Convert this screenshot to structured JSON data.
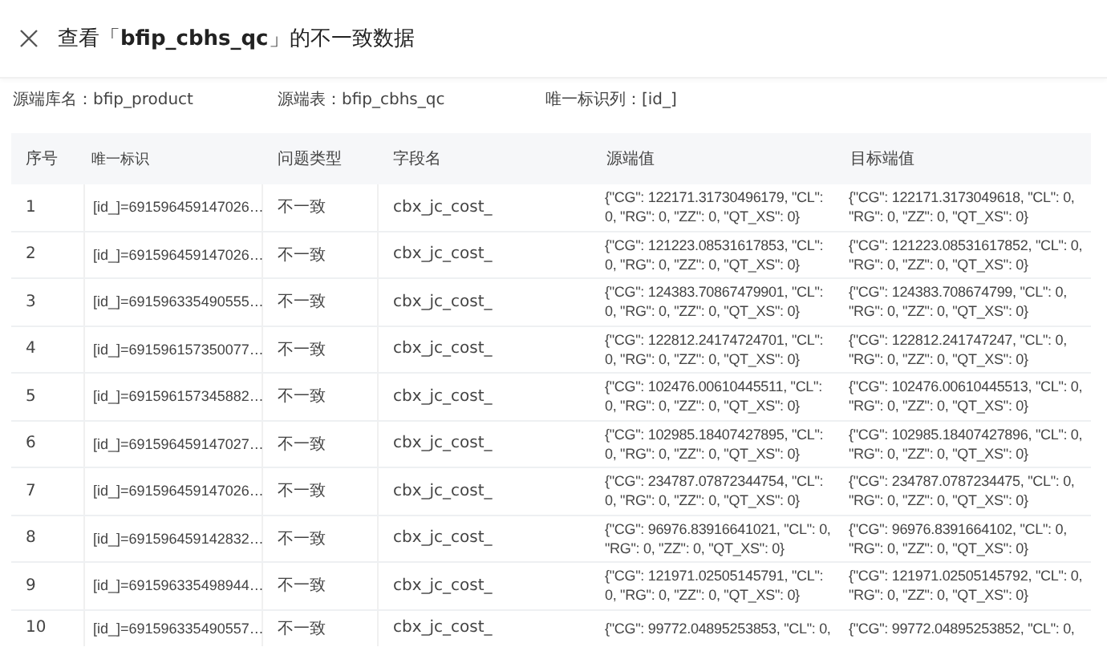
{
  "dialog": {
    "title": "查看「**bfip_cbhs_qc**」的不一致数据"
  },
  "info": [
    {
      "label": "源端库名：",
      "value": "bfip_product"
    },
    {
      "label": "源端表：",
      "value": "bfip_cbhs_qc"
    },
    {
      "label": "唯一标识列：",
      "value": "[id_]"
    }
  ],
  "table": {
    "columns": [
      "序号",
      "唯一标识",
      "问题类型",
      "字段名",
      "源端值",
      "目标端值"
    ],
    "rows": [
      [
        "1",
        "[id_]=691596459147026…",
        "不一致",
        "cbx_jc_cost_",
        "{\"CG\": 122171.31730496179, \"CL\": 0, \"RG\": 0, \"ZZ\": 0, \"QT_XS\": 0}",
        "{\"CG\": 122171.3173049618, \"CL\": 0, \"RG\": 0, \"ZZ\": 0, \"QT_XS\": 0}"
      ],
      [
        "2",
        "[id_]=691596459147026…",
        "不一致",
        "cbx_jc_cost_",
        "{\"CG\": 121223.08531617853, \"CL\": 0, \"RG\": 0, \"ZZ\": 0, \"QT_XS\": 0}",
        "{\"CG\": 121223.08531617852, \"CL\": 0, \"RG\": 0, \"ZZ\": 0, \"QT_XS\": 0}"
      ],
      [
        "3",
        "[id_]=691596335490555…",
        "不一致",
        "cbx_jc_cost_",
        "{\"CG\": 124383.70867479901, \"CL\": 0, \"RG\": 0, \"ZZ\": 0, \"QT_XS\": 0}",
        "{\"CG\": 124383.708674799, \"CL\": 0, \"RG\": 0, \"ZZ\": 0, \"QT_XS\": 0}"
      ],
      [
        "4",
        "[id_]=691596157350077…",
        "不一致",
        "cbx_jc_cost_",
        "{\"CG\": 122812.24174724701, \"CL\": 0, \"RG\": 0, \"ZZ\": 0, \"QT_XS\": 0}",
        "{\"CG\": 122812.241747247, \"CL\": 0, \"RG\": 0, \"ZZ\": 0, \"QT_XS\": 0}"
      ],
      [
        "5",
        "[id_]=691596157345882…",
        "不一致",
        "cbx_jc_cost_",
        "{\"CG\": 102476.00610445511, \"CL\": 0, \"RG\": 0, \"ZZ\": 0, \"QT_XS\": 0}",
        "{\"CG\": 102476.00610445513, \"CL\": 0, \"RG\": 0, \"ZZ\": 0, \"QT_XS\": 0}"
      ],
      [
        "6",
        "[id_]=691596459147027…",
        "不一致",
        "cbx_jc_cost_",
        "{\"CG\": 102985.18407427895, \"CL\": 0, \"RG\": 0, \"ZZ\": 0, \"QT_XS\": 0}",
        "{\"CG\": 102985.18407427896, \"CL\": 0, \"RG\": 0, \"ZZ\": 0, \"QT_XS\": 0}"
      ],
      [
        "7",
        "[id_]=691596459147026…",
        "不一致",
        "cbx_jc_cost_",
        "{\"CG\": 234787.07872344754, \"CL\": 0, \"RG\": 0, \"ZZ\": 0, \"QT_XS\": 0}",
        "{\"CG\": 234787.0787234475, \"CL\": 0, \"RG\": 0, \"ZZ\": 0, \"QT_XS\": 0}"
      ],
      [
        "8",
        "[id_]=691596459142832…",
        "不一致",
        "cbx_jc_cost_",
        "{\"CG\": 96976.83916641021, \"CL\": 0, \"RG\": 0, \"ZZ\": 0, \"QT_XS\": 0}",
        "{\"CG\": 96976.8391664102, \"CL\": 0, \"RG\": 0, \"ZZ\": 0, \"QT_XS\": 0}"
      ],
      [
        "9",
        "[id_]=691596335498944…",
        "不一致",
        "cbx_jc_cost_",
        "{\"CG\": 121971.02505145791, \"CL\": 0, \"RG\": 0, \"ZZ\": 0, \"QT_XS\": 0}",
        "{\"CG\": 121971.02505145792, \"CL\": 0, \"RG\": 0, \"ZZ\": 0, \"QT_XS\": 0}"
      ],
      [
        "10",
        "[id_]=691596335490557…",
        "不一致",
        "cbx_jc_cost_",
        "{\"CG\": 99772.04895253853, \"CL\": 0,",
        "{\"CG\": 99772.04895253852, \"CL\": 0,"
      ]
    ]
  }
}
